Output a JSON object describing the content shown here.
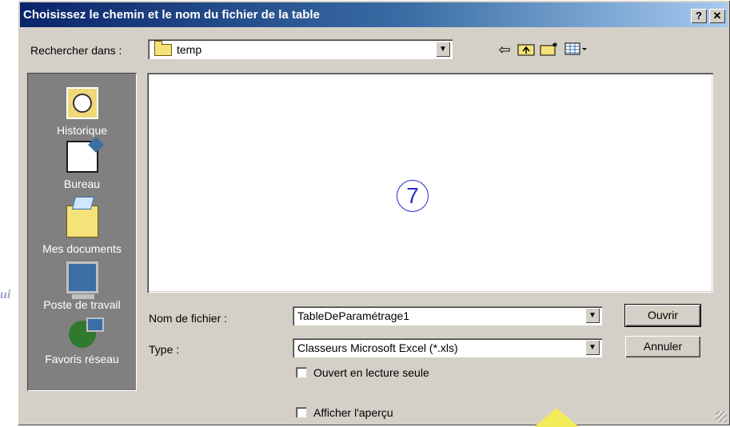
{
  "background_text": "ui",
  "dialog": {
    "title": "Choisissez le chemin et le nom du fichier de la table",
    "help_button": "?",
    "close_button": "✕"
  },
  "lookin": {
    "label": "Rechercher dans :",
    "value": "temp"
  },
  "toolbar": {
    "back_icon": "back-arrow-icon",
    "up_icon": "up-folder-icon",
    "new_folder_icon": "new-folder-icon",
    "views_icon": "views-menu-icon"
  },
  "places": [
    {
      "label": "Historique",
      "icon": "history-icon"
    },
    {
      "label": "Bureau",
      "icon": "desktop-icon"
    },
    {
      "label": "Mes documents",
      "icon": "documents-icon"
    },
    {
      "label": "Poste de travail",
      "icon": "computer-icon"
    },
    {
      "label": "Favoris réseau",
      "icon": "network-icon"
    }
  ],
  "file_list": {
    "marker": "7"
  },
  "filename": {
    "label": "Nom de fichier :",
    "value": "TableDeParamétrage1"
  },
  "filetype": {
    "label": "Type :",
    "value": "Classeurs Microsoft Excel (*.xls)"
  },
  "buttons": {
    "open": "Ouvrir",
    "cancel": "Annuler"
  },
  "options": {
    "readonly": "Ouvert en lecture seule",
    "preview": "Afficher l'aperçu"
  },
  "colors": {
    "titlebar_start": "#0a246a",
    "titlebar_end": "#a6caf0",
    "dialog_bg": "#d4d0c8",
    "places_bg": "#808080",
    "marker": "#2a2ad0"
  }
}
